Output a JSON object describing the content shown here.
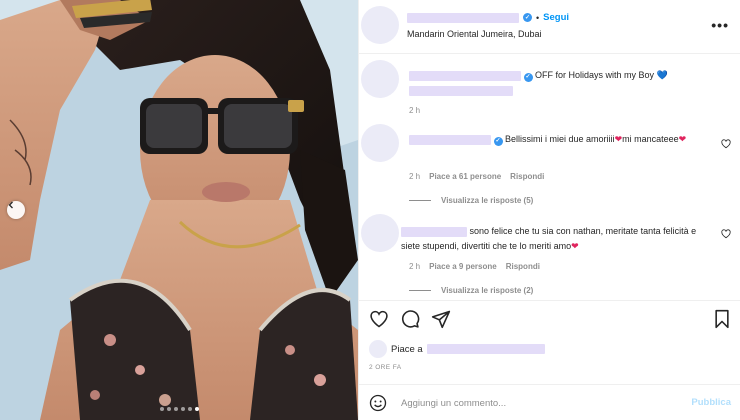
{
  "photo": {
    "description_icon_prev": "chevron-left-icon",
    "carousel_count": 6,
    "carousel_active_index": 5
  },
  "header": {
    "follow_label": "Segui",
    "separator": "•",
    "location": "Mandarin Oriental Jumeira, Dubai",
    "more_label": "•••"
  },
  "comments": [
    {
      "text": "OFF for Holidays with my Boy",
      "emoji": "💙",
      "time": "2 h"
    },
    {
      "text_before": "Bellissimi i miei due amoriiii",
      "heart1": "❤",
      "text_mid": "mi mancateee",
      "heart2": "❤",
      "time": "2 h",
      "likes": "Piace a 61 persone",
      "reply": "Rispondi",
      "view_replies": "Visualizza le risposte (5)"
    },
    {
      "text": "sono felice che tu sia con nathan, meritate tanta felicità e siete stupendi, divertiti che te lo meriti amo",
      "heart": "❤",
      "time": "2 h",
      "likes": "Piace a 9 persone",
      "reply": "Rispondi",
      "view_replies": "Visualizza le risposte (2)"
    }
  ],
  "likes": {
    "prefix": "Piace a"
  },
  "timestamp": "2 ORE FA",
  "add_comment": {
    "placeholder": "Aggiungi un commento...",
    "publish_label": "Pubblica"
  },
  "colors": {
    "accent": "#0095f6",
    "verified": "#3897f0",
    "heart": "#e0245e",
    "blue_heart": "#1f6fd1"
  }
}
